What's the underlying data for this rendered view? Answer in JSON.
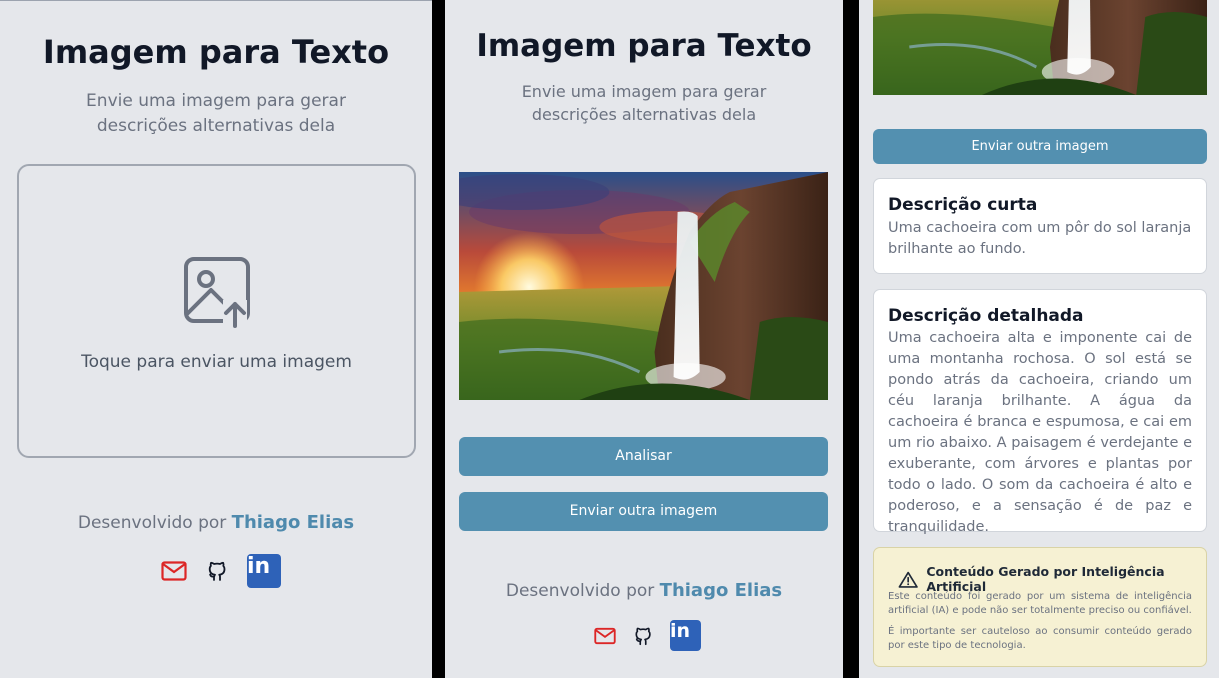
{
  "app": {
    "title": "Imagem para Texto",
    "subtitle": "Envie uma imagem para gerar descrições alternativas dela"
  },
  "upload": {
    "label": "Toque para enviar uma imagem",
    "icon": "image-upload-icon"
  },
  "footer": {
    "prefix": "Desenvolvido por",
    "author": "Thiago Elias",
    "social": [
      {
        "name": "email",
        "icon": "mail-icon",
        "color": "#dc2626"
      },
      {
        "name": "github",
        "icon": "github-icon",
        "color": "#111827"
      },
      {
        "name": "linkedin",
        "icon": "linkedin-icon",
        "color": "#2e62b8",
        "text": "in"
      }
    ]
  },
  "buttons": {
    "analyze": "Analisar",
    "send_another": "Enviar outra imagem"
  },
  "image": {
    "subject": "waterfall-sunset-photo"
  },
  "results": {
    "short": {
      "title": "Descrição curta",
      "text": "Uma cachoeira com um pôr do sol laranja brilhante ao fundo."
    },
    "detailed": {
      "title": "Descrição detalhada",
      "text": "Uma cachoeira alta e imponente cai de uma montanha rochosa. O sol está se pondo atrás da cachoeira, criando um céu laranja brilhante. A água da cachoeira é branca e espumosa, e cai em um rio abaixo. A paisagem é verdejante e exuberante, com árvores e plantas por todo o lado. O som da cachoeira é alto e poderoso, e a sensação é de paz e tranquilidade."
    }
  },
  "ai_notice": {
    "title": "Conteúdo Gerado por Inteligência Artificial",
    "text1": "Este conteúdo foi gerado por um sistema de inteligência artificial (IA) e pode não ser totalmente preciso ou confiável.",
    "text2": "É importante ser cauteloso ao consumir conteúdo gerado por este tipo de tecnologia."
  },
  "colors": {
    "background": "#e5e7eb",
    "accent": "#5390b0",
    "author_link": "#4f8aad",
    "warning_bg": "#f6f1d3"
  }
}
